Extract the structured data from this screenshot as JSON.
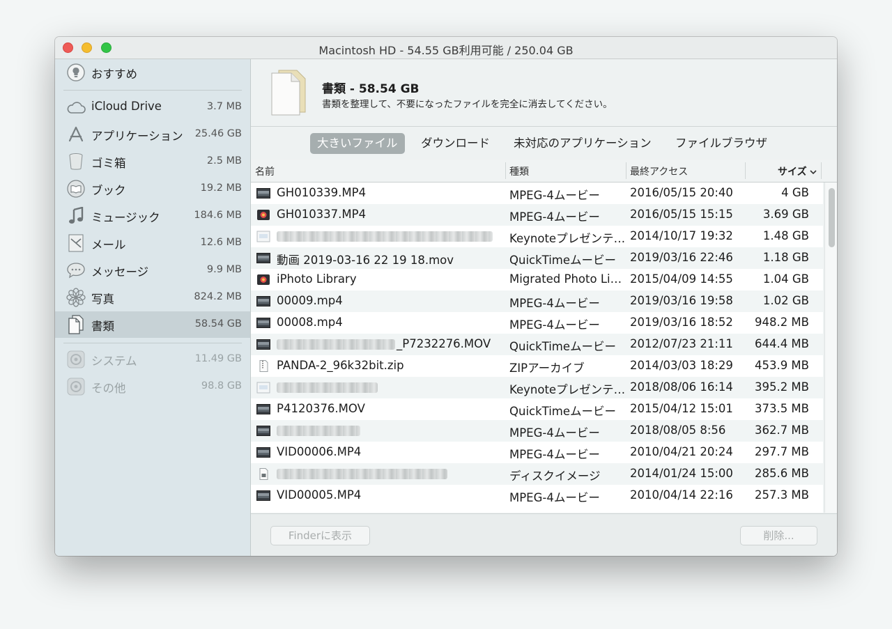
{
  "window": {
    "title": "Macintosh HD - 54.55 GB利用可能 / 250.04 GB"
  },
  "sidebar": {
    "recommend": {
      "label": "おすすめ",
      "icon": "lightbulb-icon"
    },
    "items": [
      {
        "label": "iCloud Drive",
        "size": "3.7 MB",
        "icon": "cloud-icon"
      },
      {
        "label": "アプリケーション",
        "size": "25.46 GB",
        "icon": "app-store-icon"
      },
      {
        "label": "ゴミ箱",
        "size": "2.5 MB",
        "icon": "trash-icon"
      },
      {
        "label": "ブック",
        "size": "19.2 MB",
        "icon": "book-icon"
      },
      {
        "label": "ミュージック",
        "size": "184.6 MB",
        "icon": "music-note-icon"
      },
      {
        "label": "メール",
        "size": "12.6 MB",
        "icon": "mail-icon"
      },
      {
        "label": "メッセージ",
        "size": "9.9 MB",
        "icon": "chat-bubble-icon"
      },
      {
        "label": "写真",
        "size": "824.2 MB",
        "icon": "photos-flower-icon"
      },
      {
        "label": "書類",
        "size": "58.54 GB",
        "icon": "document-icon",
        "selected": true
      }
    ],
    "system_items": [
      {
        "label": "システム",
        "size": "11.49 GB",
        "icon": "system-gear-icon"
      },
      {
        "label": "その他",
        "size": "98.8 GB",
        "icon": "other-gear-icon"
      }
    ]
  },
  "header": {
    "title": "書類 - 58.54 GB",
    "subtitle": "書類を整理して、不要になったファイルを完全に消去してください。",
    "icon": "document-stack-icon"
  },
  "tabs": [
    {
      "label": "大きいファイル",
      "active": true
    },
    {
      "label": "ダウンロード"
    },
    {
      "label": "未対応のアプリケーション"
    },
    {
      "label": "ファイルブラウザ"
    }
  ],
  "table": {
    "columns": {
      "name": "名前",
      "kind": "種類",
      "last_access": "最終アクセス",
      "size": "サイズ"
    },
    "sort_indicator": "chevron-down-icon",
    "rows": [
      {
        "name": "GH010339.MP4",
        "kind": "MPEG-4ムービー",
        "date": "2016/05/15 20:40",
        "size": "4 GB",
        "icon": "video-thumb-icon"
      },
      {
        "name": "GH010337.MP4",
        "kind": "MPEG-4ムービー",
        "date": "2016/05/15 15:15",
        "size": "3.69 GB",
        "icon": "photo-library-icon"
      },
      {
        "name": "",
        "kind": "Keynoteプレゼンテ…",
        "date": "2014/10/17 19:32",
        "size": "1.48 GB",
        "icon": "keynote-file-icon",
        "obscured": true
      },
      {
        "name": "動画 2019-03-16 22 19 18.mov",
        "kind": "QuickTimeムービー",
        "date": "2019/03/16 22:46",
        "size": "1.18 GB",
        "icon": "video-thumb-icon"
      },
      {
        "name": "iPhoto Library",
        "kind": "Migrated Photo Li…",
        "date": "2015/04/09 14:55",
        "size": "1.04 GB",
        "icon": "photo-library-icon"
      },
      {
        "name": "00009.mp4",
        "kind": "MPEG-4ムービー",
        "date": "2019/03/16 19:58",
        "size": "1.02 GB",
        "icon": "video-thumb-icon"
      },
      {
        "name": "00008.mp4",
        "kind": "MPEG-4ムービー",
        "date": "2019/03/16 18:52",
        "size": "948.2 MB",
        "icon": "video-thumb-icon"
      },
      {
        "name": "_P7232276.MOV",
        "kind": "QuickTimeムービー",
        "date": "2012/07/23 21:11",
        "size": "644.4 MB",
        "icon": "video-thumb-icon",
        "partly_obscured": true
      },
      {
        "name": "PANDA-2_96k32bit.zip",
        "kind": "ZIPアーカイブ",
        "date": "2014/03/03 18:29",
        "size": "453.9 MB",
        "icon": "zip-file-icon"
      },
      {
        "name": "",
        "kind": "Keynoteプレゼンテ…",
        "date": "2018/08/06 16:14",
        "size": "395.2 MB",
        "icon": "keynote-file-icon",
        "obscured": true
      },
      {
        "name": "P4120376.MOV",
        "kind": "QuickTimeムービー",
        "date": "2015/04/12 15:01",
        "size": "373.5 MB",
        "icon": "video-thumb-icon"
      },
      {
        "name": "",
        "kind": "MPEG-4ムービー",
        "date": "2018/08/05 8:56",
        "size": "362.7 MB",
        "icon": "video-thumb-icon",
        "obscured": true
      },
      {
        "name": "VID00006.MP4",
        "kind": "MPEG-4ムービー",
        "date": "2010/04/21 20:24",
        "size": "297.7 MB",
        "icon": "video-thumb-icon"
      },
      {
        "name": "",
        "kind": "ディスクイメージ",
        "date": "2014/01/24 15:00",
        "size": "285.6 MB",
        "icon": "disk-image-icon",
        "obscured": true
      },
      {
        "name": "VID00005.MP4",
        "kind": "MPEG-4ムービー",
        "date": "2010/04/14 22:16",
        "size": "257.3 MB",
        "icon": "video-thumb-icon"
      }
    ]
  },
  "footer": {
    "finder_button": "Finderに表示",
    "delete_button": "削除..."
  }
}
